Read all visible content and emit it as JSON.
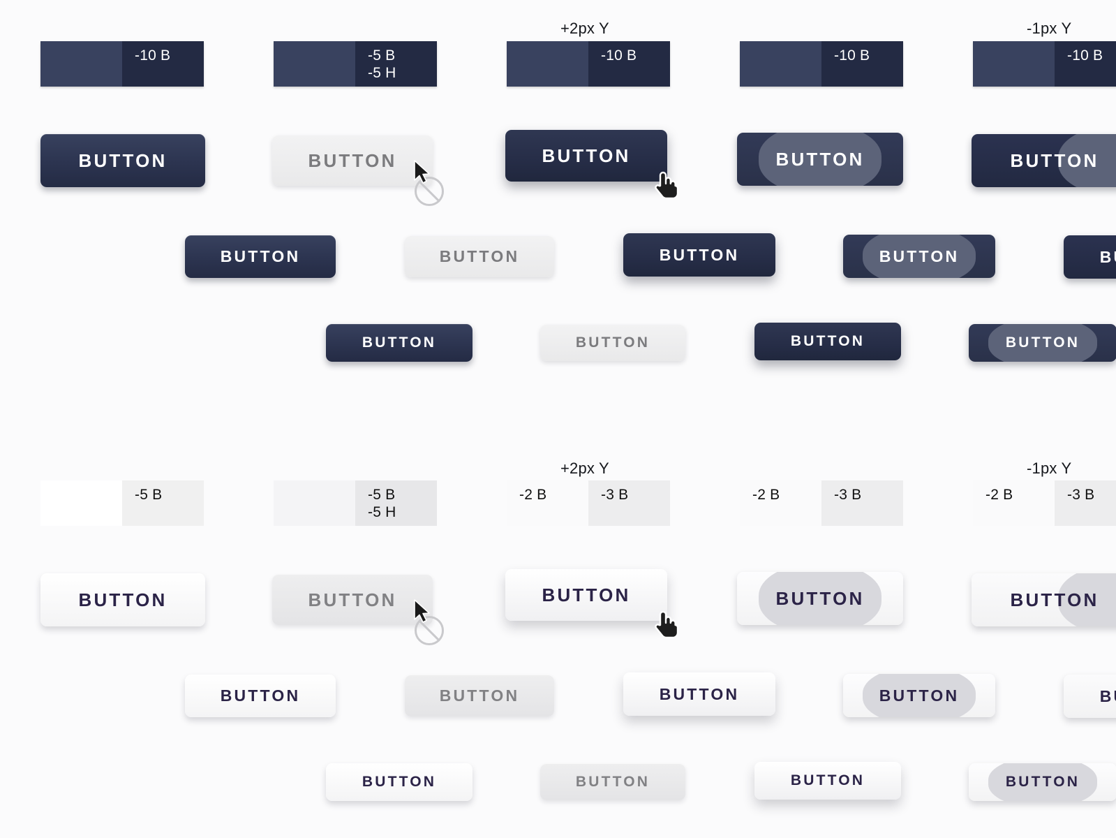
{
  "meta": {
    "background": "#fbfbfc",
    "accent_dark": "#2c3450",
    "accent_dark_deep": "#232a43",
    "accent_light_text": "#2b2347",
    "disabled_text": "#7b7b7e",
    "ripple_dark": "#5c6379",
    "ripple_light": "#d8d8dd",
    "button_label": "BUTTON"
  },
  "column_labels": {
    "hover_offset": "+2px Y",
    "focus_offset": "-1px Y"
  },
  "dark_section": {
    "specs": [
      {
        "name": "default",
        "left": "",
        "right": "-10 B"
      },
      {
        "name": "disabled",
        "left": "",
        "right": "-5 B\n-5 H"
      },
      {
        "name": "hover",
        "left": "",
        "right": "-10 B",
        "label": "+2px Y"
      },
      {
        "name": "active",
        "left": "",
        "right": "-10 B"
      },
      {
        "name": "focus",
        "left": "",
        "right": "-10 B",
        "label": "-1px Y"
      }
    ],
    "rows": [
      {
        "size": "xl",
        "buttons": [
          {
            "state": "default",
            "label": "BUTTON"
          },
          {
            "state": "disabled",
            "label": "BUTTON"
          },
          {
            "state": "hover",
            "label": "BUTTON"
          },
          {
            "state": "active",
            "label": "BUTTON"
          },
          {
            "state": "focus",
            "label": "BUTTON"
          }
        ]
      },
      {
        "size": "lg",
        "buttons": [
          {
            "state": "default",
            "label": "BUTTON"
          },
          {
            "state": "disabled",
            "label": "BUTTON"
          },
          {
            "state": "hover",
            "label": "BUTTON"
          },
          {
            "state": "active",
            "label": "BUTTON"
          },
          {
            "state": "focus",
            "label": "BUTTON"
          }
        ]
      },
      {
        "size": "md",
        "buttons": [
          {
            "state": "default",
            "label": "BUTTON"
          },
          {
            "state": "disabled",
            "label": "BUTTON"
          },
          {
            "state": "hover",
            "label": "BUTTON"
          },
          {
            "state": "active",
            "label": "BUTTON"
          }
        ]
      }
    ]
  },
  "light_section": {
    "specs": [
      {
        "name": "default",
        "left": "",
        "right": "-5 B"
      },
      {
        "name": "disabled",
        "left": "",
        "right": "-5 B\n-5 H"
      },
      {
        "name": "hover",
        "left": "-2 B",
        "right": "-3 B",
        "label": "+2px Y"
      },
      {
        "name": "active",
        "left": "-2 B",
        "right": "-3 B"
      },
      {
        "name": "focus",
        "left": "-2 B",
        "right": "-3 B",
        "label": "-1px Y"
      }
    ],
    "rows": [
      {
        "size": "xl",
        "buttons": [
          {
            "state": "default",
            "label": "BUTTON"
          },
          {
            "state": "disabled",
            "label": "BUTTON"
          },
          {
            "state": "hover",
            "label": "BUTTON"
          },
          {
            "state": "active",
            "label": "BUTTON"
          },
          {
            "state": "focus",
            "label": "BUTTON"
          }
        ]
      },
      {
        "size": "lg",
        "buttons": [
          {
            "state": "default",
            "label": "BUTTON"
          },
          {
            "state": "disabled",
            "label": "BUTTON"
          },
          {
            "state": "hover",
            "label": "BUTTON"
          },
          {
            "state": "active",
            "label": "BUTTON"
          },
          {
            "state": "focus",
            "label": "BUTTON"
          }
        ]
      },
      {
        "size": "md",
        "buttons": [
          {
            "state": "default",
            "label": "BUTTON"
          },
          {
            "state": "disabled",
            "label": "BUTTON"
          },
          {
            "state": "hover",
            "label": "BUTTON"
          },
          {
            "state": "active",
            "label": "BUTTON"
          }
        ]
      }
    ]
  },
  "cursors": [
    {
      "kind": "arrow-cursor",
      "note": "not-allowed"
    },
    {
      "kind": "pointer-hand-cursor",
      "note": "hover"
    }
  ]
}
